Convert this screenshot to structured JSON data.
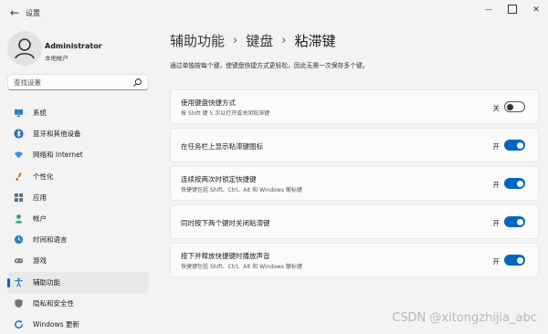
{
  "window": {
    "title": "设置"
  },
  "profile": {
    "name": "Administrator",
    "subtitle": "本地帐户"
  },
  "search": {
    "placeholder": "查找设置"
  },
  "sidebar": {
    "items": [
      {
        "label": "系统",
        "icon": "monitor-icon",
        "color": "#2a7fd4"
      },
      {
        "label": "蓝牙和其他设备",
        "icon": "bluetooth-icon",
        "color": "#1f6fc4"
      },
      {
        "label": "网络和 Internet",
        "icon": "wifi-icon",
        "color": "#3b8fde"
      },
      {
        "label": "个性化",
        "icon": "brush-icon",
        "color": "#d77a35"
      },
      {
        "label": "应用",
        "icon": "apps-icon",
        "color": "#5a6a7a"
      },
      {
        "label": "帐户",
        "icon": "person-icon",
        "color": "#2aa36b"
      },
      {
        "label": "时间和语言",
        "icon": "globe-clock-icon",
        "color": "#2a7fd4"
      },
      {
        "label": "游戏",
        "icon": "gamepad-icon",
        "color": "#6b7785"
      },
      {
        "label": "辅助功能",
        "icon": "accessibility-icon",
        "color": "#1f6fc4",
        "active": true
      },
      {
        "label": "隐私和安全性",
        "icon": "shield-icon",
        "color": "#6b7785"
      },
      {
        "label": "Windows 更新",
        "icon": "update-icon",
        "color": "#1f6fc4"
      }
    ]
  },
  "breadcrumb": {
    "part1": "辅助功能",
    "part2": "键盘",
    "current": "粘滞键",
    "separator": "›"
  },
  "description": "通过单独按每个键，使键盘快捷方式更轻松，因此无需一次保存多个键。",
  "settings": [
    {
      "title": "使用键盘快捷方式",
      "subtitle": "按 Shift 键 5 次以打开或关闭粘滞键",
      "state": "关",
      "on": false
    },
    {
      "title": "在任务栏上显示粘滞键图标",
      "subtitle": "",
      "state": "开",
      "on": true
    },
    {
      "title": "连续按两次时锁定快捷键",
      "subtitle": "快捷键包括 Shift、Ctrl、Alt 和 Windows 徽标键",
      "state": "开",
      "on": true
    },
    {
      "title": "同时按下两个键时关闭粘滞键",
      "subtitle": "",
      "state": "开",
      "on": true
    },
    {
      "title": "按下并释放快捷键时播放声音",
      "subtitle": "快捷键包括 Shift、Ctrl、Alt 和 Windows 徽标键",
      "state": "开",
      "on": true
    }
  ],
  "watermark": "CSDN @xitongzhijia_abc",
  "colors": {
    "accent": "#0067c0",
    "background": "#f3f3f3",
    "card": "#fbfbfb"
  }
}
